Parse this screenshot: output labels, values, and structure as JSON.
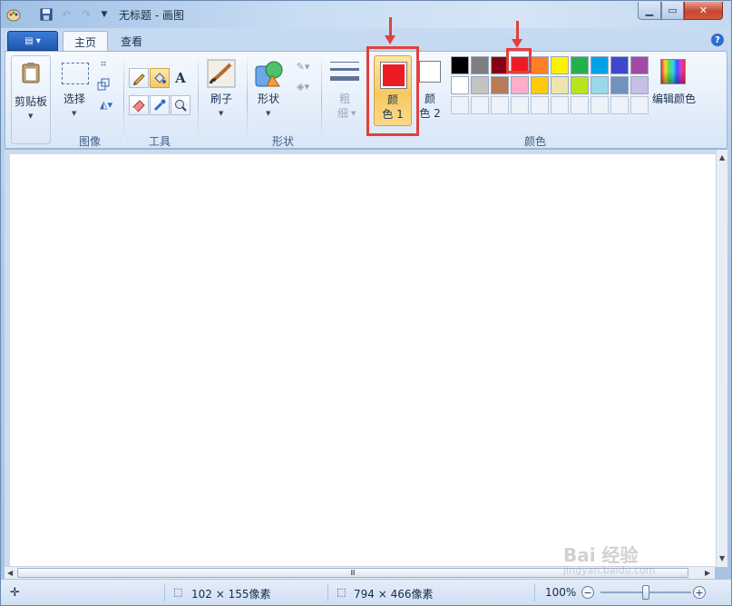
{
  "window": {
    "title": "无标题 - 画图",
    "min_symbol": "▁",
    "max_symbol": "▭",
    "close_symbol": "✕"
  },
  "tabs": {
    "file_symbol": "▤ ▾",
    "home": "主页",
    "view": "查看",
    "help_symbol": "?"
  },
  "ribbon": {
    "clipboard": {
      "label": "剪贴板"
    },
    "image": {
      "select_label": "选择",
      "group_label": "图像"
    },
    "tools": {
      "group_label": "工具"
    },
    "brushes": {
      "label": "刷子"
    },
    "shapes": {
      "label": "形状",
      "group_label": "形状"
    },
    "size": {
      "label_line1": "粗",
      "label_line2": "细"
    },
    "color1": {
      "label_line1": "颜",
      "label_line2": "色 1",
      "value": "#ed1c24"
    },
    "color2": {
      "label_line1": "颜",
      "label_line2": "色 2",
      "value": "#ffffff"
    },
    "colors": {
      "group_label": "颜色",
      "edit_label": "编辑颜色"
    }
  },
  "palette": {
    "row1": [
      "#000000",
      "#7f7f7f",
      "#880015",
      "#ed1c24",
      "#ff7f27",
      "#fff200",
      "#22b14c",
      "#00a2e8",
      "#3f48cc",
      "#a349a4"
    ],
    "row2": [
      "#ffffff",
      "#c3c3c3",
      "#b97a57",
      "#ffaec9",
      "#ffc90e",
      "#efe4b0",
      "#b5e61d",
      "#99d9ea",
      "#7092be",
      "#c8bfe7"
    ],
    "empty_slots": 10,
    "highlighted_index": 3
  },
  "status": {
    "cursor_pos": "",
    "selection_size": "102 × 155像素",
    "canvas_size": "794 × 466像素",
    "zoom": "100%",
    "zoom_level_percent": 100
  },
  "watermark": {
    "text": "Bai 经验",
    "sub": "jingyan.baidu.com"
  },
  "scroll": {
    "grip": "Ⅲ"
  }
}
